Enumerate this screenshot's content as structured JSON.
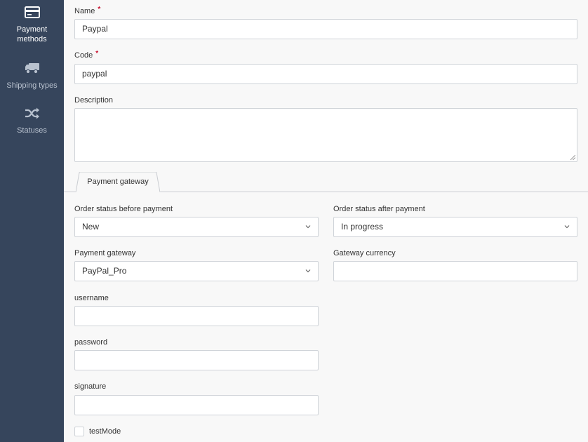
{
  "sidebar": {
    "items": [
      {
        "label_line1": "Payment",
        "label_line2": "methods",
        "icon": "credit-card-icon",
        "active": true
      },
      {
        "label": "Shipping types",
        "icon": "truck-icon",
        "active": false
      },
      {
        "label": "Statuses",
        "icon": "shuffle-icon",
        "active": false
      }
    ]
  },
  "form": {
    "name": {
      "label": "Name",
      "required_mark": "*",
      "value": "Paypal"
    },
    "code": {
      "label": "Code",
      "required_mark": "*",
      "value": "paypal"
    },
    "description": {
      "label": "Description",
      "value": ""
    }
  },
  "tabs": [
    {
      "label": "Payment gateway",
      "active": true
    }
  ],
  "gateway": {
    "status_before": {
      "label": "Order status before payment",
      "value": "New"
    },
    "status_after": {
      "label": "Order status after payment",
      "value": "In progress"
    },
    "payment_gateway": {
      "label": "Payment gateway",
      "value": "PayPal_Pro"
    },
    "gateway_currency": {
      "label": "Gateway currency",
      "value": ""
    },
    "username": {
      "label": "username",
      "value": ""
    },
    "password": {
      "label": "password",
      "value": ""
    },
    "signature": {
      "label": "signature",
      "value": ""
    },
    "test_mode": {
      "label": "testMode",
      "checked": false
    }
  },
  "colors": {
    "sidebar_bg": "#36455c",
    "required": "#c8102e",
    "border": "#cfd3d8"
  }
}
